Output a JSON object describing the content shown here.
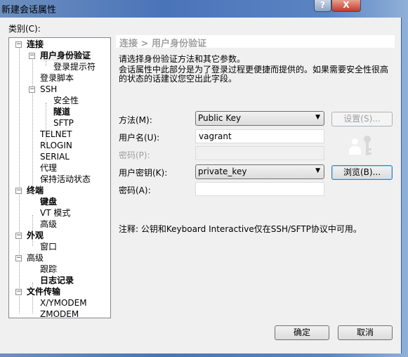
{
  "window": {
    "title": "新建会话属性",
    "help_label": "?",
    "close_label": "X"
  },
  "category_label": "类别(C):",
  "tree": [
    {
      "label": "连接",
      "level": 0,
      "bold": true,
      "expander": "−"
    },
    {
      "label": "用户身份验证",
      "level": 1,
      "bold": true,
      "expander": "−",
      "selected": true
    },
    {
      "label": "登录提示符",
      "level": 2
    },
    {
      "label": "登录脚本",
      "level": 1
    },
    {
      "label": "SSH",
      "level": 1,
      "expander": "−"
    },
    {
      "label": "安全性",
      "level": 2
    },
    {
      "label": "隧道",
      "level": 2,
      "bold": true
    },
    {
      "label": "SFTP",
      "level": 2
    },
    {
      "label": "TELNET",
      "level": 1
    },
    {
      "label": "RLOGIN",
      "level": 1
    },
    {
      "label": "SERIAL",
      "level": 1
    },
    {
      "label": "代理",
      "level": 1
    },
    {
      "label": "保持活动状态",
      "level": 1
    },
    {
      "label": "终端",
      "level": 0,
      "bold": true,
      "expander": "−"
    },
    {
      "label": "键盘",
      "level": 1,
      "bold": true
    },
    {
      "label": "VT 模式",
      "level": 1
    },
    {
      "label": "高级",
      "level": 1
    },
    {
      "label": "外观",
      "level": 0,
      "bold": true,
      "expander": "−"
    },
    {
      "label": "窗口",
      "level": 1
    },
    {
      "label": "高级",
      "level": 0,
      "expander": "−"
    },
    {
      "label": "跟踪",
      "level": 1
    },
    {
      "label": "日志记录",
      "level": 1,
      "bold": true
    },
    {
      "label": "文件传输",
      "level": 0,
      "bold": true,
      "expander": "−"
    },
    {
      "label": "X/YMODEM",
      "level": 1
    },
    {
      "label": "ZMODEM",
      "level": 1
    }
  ],
  "panel": {
    "breadcrumb": "连接 > 用户身份验证",
    "intro": "请选择身份验证方法和其它参数。",
    "desc": "会话属性中此部分是为了登录过程更便捷而提供的。如果需要安全性很高的状态的话建议您空出此字段。",
    "method_label": "方法(M):",
    "method_value": "Public Key",
    "settings_button": "设置(S)...",
    "username_label": "用户名(U):",
    "username_value": "vagrant",
    "password_label": "密码(P):",
    "password_value": "",
    "userkey_label": "用户密钥(K):",
    "userkey_value": "private_key",
    "browse_button": "浏览(B)...",
    "passphrase_label": "密码(A):",
    "passphrase_value": "",
    "note": "注释: 公钥和Keyboard Interactive仅在SSH/SFTP协议中可用。",
    "icon": "user-key-icon"
  },
  "footer": {
    "ok": "确定",
    "cancel": "取消"
  }
}
